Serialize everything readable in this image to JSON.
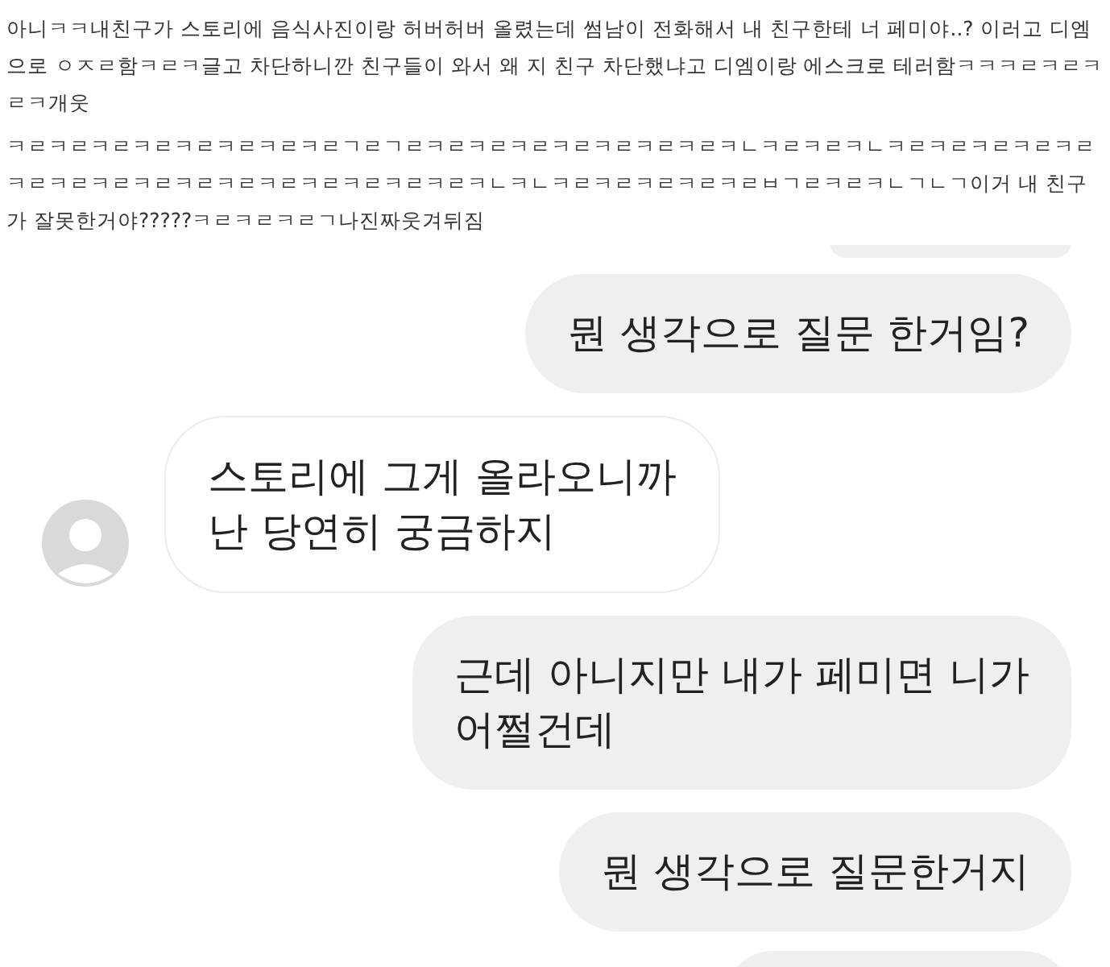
{
  "post": {
    "paragraphs": [
      "아니ㅋㅋ내친구가 스토리에 음식사진이랑 허버허버 올렸는데 썸남이 전화해서 내 친구한테 너 페미야..? 이러고 디엠으로 ㅇㅈㄹ함ㅋㄹㅋ글고 차단하니깐 친구들이 와서 왜 지 친구 차단했냐고 디엠이랑 에스크로 테러함ㅋㅋㅋㄹㅋㄹㅋㄹㅋ개웃",
      "ㅋㄹㅋㄹㅋㄹㅋㄹㅋㄹㅋㄹㅋㄹㅋㄹㄱㄹㄱㄹㅋㄹㅋㄹㅋㄹㅋㄹㅋㄹㅋㄹㅋㄹㅋㄴㅋㄹㅋㄹㅋㄴㅋㄹㅋㄹㅋㄹㅋㄹㅋㄹㅋㄹㅋㄹㅋㄹㅋㄹㅋㄹㅋㄹㅋㄹㅋㄹㅋㄹㅋㄹㅋㄹㅋㄴㅋㄴㅋㄹㅋㄹㅋㄹㅋㄹㅋㄹㅂㄱㄹㅋㄹㅋㄴㄱㄴㄱ이거 내 친구가 잘못한거야?????ㅋㄹㅋㄹㅋㄹㄱ나진짜웃겨뒤짐"
    ]
  },
  "messages": [
    {
      "kind": "sent",
      "text": "뭔 생각으로 질문 한거임?"
    },
    {
      "kind": "received",
      "text": "스토리에 그게 올라오니까\n난 당연히 궁금하지"
    },
    {
      "kind": "sent",
      "text": "근데 아니지만 내가 페미면 니가\n어쩔건데"
    },
    {
      "kind": "sent",
      "text": "뭔 생각으로 질문한거지"
    }
  ]
}
